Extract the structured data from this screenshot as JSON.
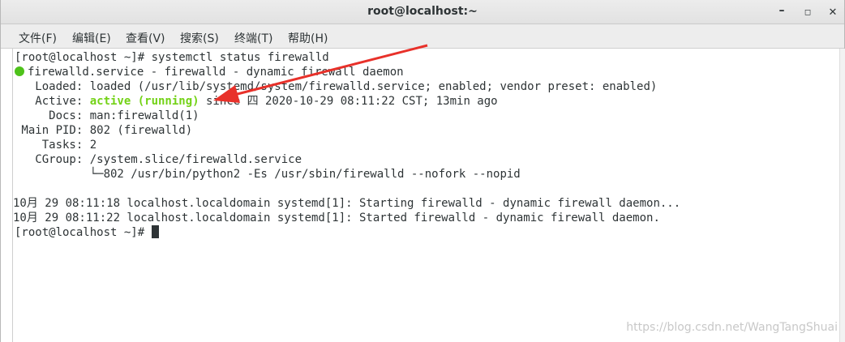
{
  "window": {
    "title": "root@localhost:~",
    "controls": {
      "minimize": "–",
      "maximize": "◻",
      "close": "✕"
    }
  },
  "menu": [
    "文件(F)",
    "编辑(E)",
    "查看(V)",
    "搜索(S)",
    "终端(T)",
    "帮助(H)"
  ],
  "terminal": {
    "prompt1": "[root@localhost ~]# systemctl status firewalld",
    "service_line": "firewalld.service - firewalld - dynamic firewall daemon",
    "loaded": "   Loaded: loaded (/usr/lib/systemd/system/firewalld.service; enabled; vendor preset: enabled)",
    "active_label": "   Active: ",
    "active_status": "active (running)",
    "active_since": " since 四 2020-10-29 08:11:22 CST; 13min ago",
    "docs": "     Docs: man:firewalld(1)",
    "main_pid": " Main PID: 802 (firewalld)",
    "tasks": "    Tasks: 2",
    "cgroup": "   CGroup: /system.slice/firewalld.service",
    "cgroup_child": "           └─802 /usr/bin/python2 -Es /usr/sbin/firewalld --nofork --nopid",
    "log1": "10月 29 08:11:18 localhost.localdomain systemd[1]: Starting firewalld - dynamic firewall daemon...",
    "log2": "10月 29 08:11:22 localhost.localdomain systemd[1]: Started firewalld - dynamic firewall daemon.",
    "prompt2": "[root@localhost ~]# "
  },
  "watermark": "https://blog.csdn.net/WangTangShuai",
  "colors": {
    "status_green": "#73d216",
    "arrow_red": "#e8312a"
  }
}
